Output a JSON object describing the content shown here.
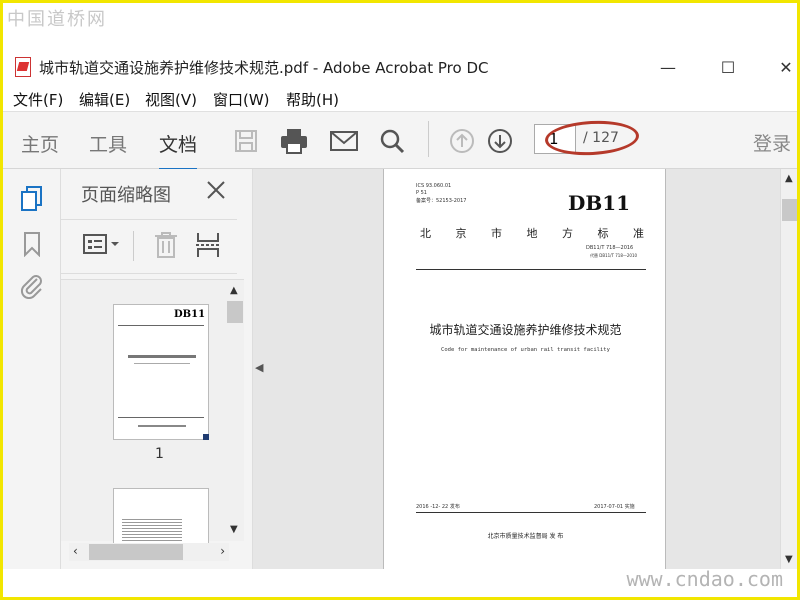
{
  "watermark_top": "中国道桥网",
  "watermark_bottom": "www.cndao.com",
  "window": {
    "title": "城市轨道交通设施养护维修技术规范.pdf - Adobe Acrobat Pro DC",
    "minimize": "—",
    "maximize": "☐",
    "close": "✕"
  },
  "menu": [
    "文件(F)",
    "编辑(E)",
    "视图(V)",
    "窗口(W)",
    "帮助(H)"
  ],
  "toolbar": {
    "tabs": [
      "主页",
      "工具",
      "文档"
    ],
    "active_tab": "文档",
    "page_current": "1",
    "page_total": "/ 127",
    "login": "登录"
  },
  "panel": {
    "title": "页面缩略图",
    "thumb_label": "1"
  },
  "document": {
    "ics": "ICS 93.060.01",
    "class": "P 51",
    "filing": "备案号：52153-2017",
    "logo": "DB11",
    "region": [
      "北",
      "京",
      "市",
      "地",
      "方",
      "标",
      "准"
    ],
    "number": "DB11/T 718—2016",
    "replaces": "代替 DB11/T 718—2010",
    "title_cn": "城市轨道交通设施养护维修技术规范",
    "title_en": "Code for maintenance of urban rail transit facility",
    "issued": "2016 -12- 22 发布",
    "effective": "2017-07-01 实施",
    "issuer": "北京市质量技术监督局    发 布"
  }
}
